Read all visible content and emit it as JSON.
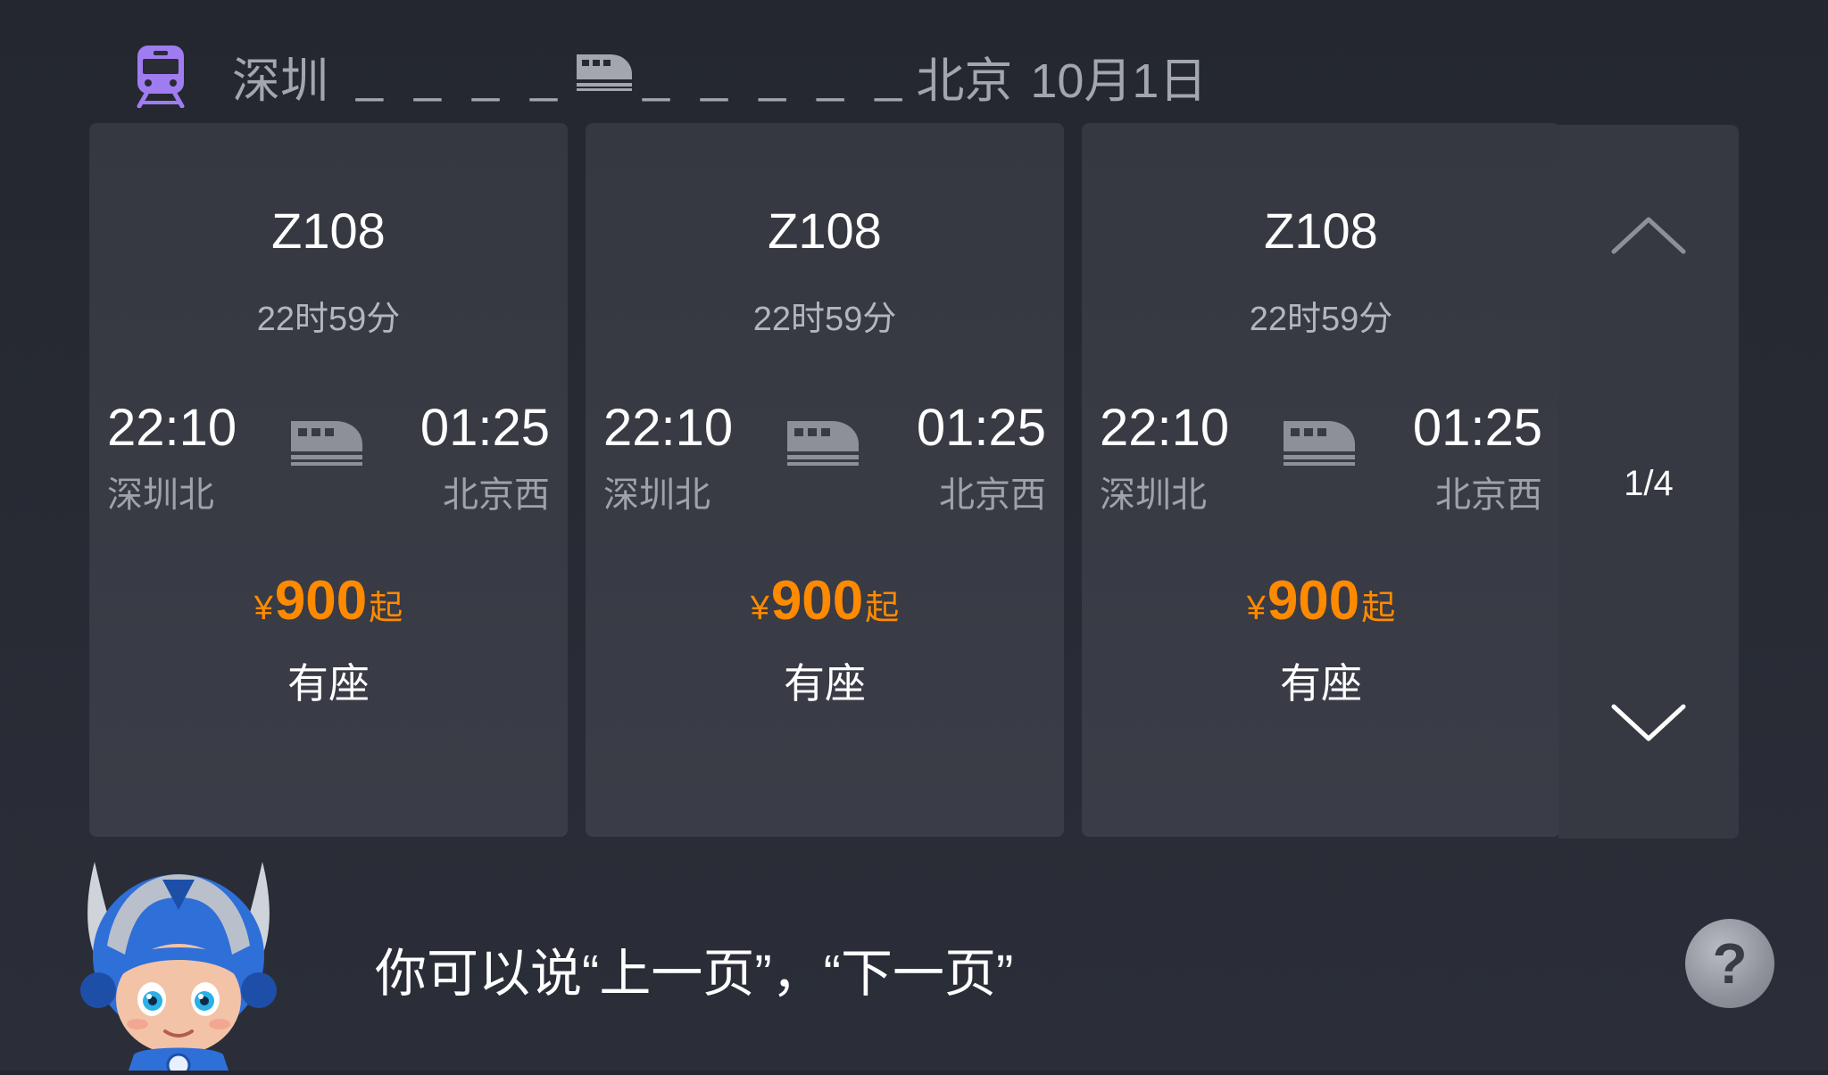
{
  "header": {
    "origin": "深圳",
    "destination": "北京",
    "date": "10月1日"
  },
  "trains": [
    {
      "train_no": "Z108",
      "duration": "22时59分",
      "depart_time": "22:10",
      "depart_station": "深圳北",
      "arrive_time": "01:25",
      "arrive_station": "北京西",
      "price_currency": "¥",
      "price_value": "900",
      "price_suffix": "起",
      "seat_status": "有座"
    },
    {
      "train_no": "Z108",
      "duration": "22时59分",
      "depart_time": "22:10",
      "depart_station": "深圳北",
      "arrive_time": "01:25",
      "arrive_station": "北京西",
      "price_currency": "¥",
      "price_value": "900",
      "price_suffix": "起",
      "seat_status": "有座"
    },
    {
      "train_no": "Z108",
      "duration": "22时59分",
      "depart_time": "22:10",
      "depart_station": "深圳北",
      "arrive_time": "01:25",
      "arrive_station": "北京西",
      "price_currency": "¥",
      "price_value": "900",
      "price_suffix": "起",
      "seat_status": "有座"
    }
  ],
  "pager": {
    "page": "1/4"
  },
  "hint": "你可以说“上一页”，“下一页”",
  "help": "?",
  "colors": {
    "background": "#262930",
    "card": "#383a44",
    "price": "#ff8a00",
    "train_badge": "#9f7cf0",
    "muted_text": "#a3a6ad"
  },
  "icons": [
    "train-icon",
    "bullet-train-icon",
    "chevron-up-icon",
    "chevron-down-icon",
    "robot-mascot",
    "help-icon"
  ]
}
